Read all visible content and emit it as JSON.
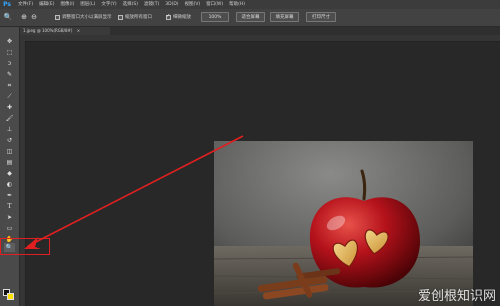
{
  "app": {
    "logo": "Ps"
  },
  "menus": [
    "文件(F)",
    "编辑(E)",
    "图像(I)",
    "图层(L)",
    "文字(Y)",
    "选择(S)",
    "滤镜(T)",
    "3D(D)",
    "视图(V)",
    "窗口(W)",
    "帮助(H)"
  ],
  "options_bar": {
    "resize_windows_label": "调整窗口大小以满屏显示",
    "zoom_all_windows_label": "缩放所有窗口",
    "scrubby_zoom_label": "细微缩放",
    "actual_pixels_button": "100%",
    "fit_screen_button": "适合屏幕",
    "fill_screen_button": "填充屏幕",
    "print_size_button": "打印尺寸",
    "resize_windows_checked": false,
    "zoom_all_windows_checked": false,
    "scrubby_zoom_checked": true
  },
  "document": {
    "tab_title": "1.jpeg @ 100%(RGB/8#)",
    "close_glyph": "×"
  },
  "toolbox": {
    "tools": [
      "move-tool",
      "marquee-tool",
      "lasso-tool",
      "quick-select-tool",
      "crop-tool",
      "eyedropper-tool",
      "healing-tool",
      "brush-tool",
      "clone-tool",
      "history-brush-tool",
      "eraser-tool",
      "gradient-tool",
      "blur-tool",
      "dodge-tool",
      "pen-tool",
      "type-tool",
      "path-select-tool",
      "shape-tool",
      "hand-tool",
      "zoom-tool"
    ],
    "foreground_color": "#111111",
    "background_color": "#ffe100"
  },
  "annotation": {
    "color": "#e02020"
  },
  "watermark": "爱创根知识网"
}
